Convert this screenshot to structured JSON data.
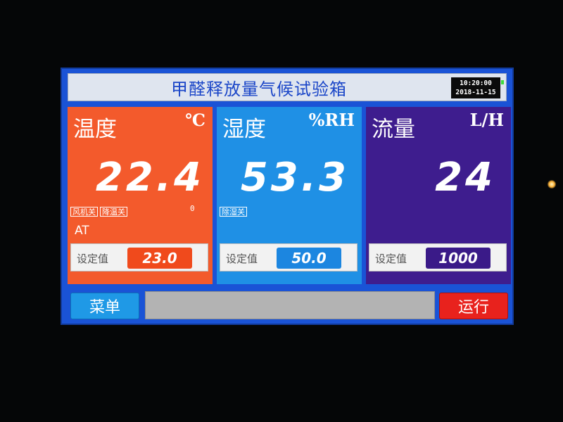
{
  "header": {
    "title": "甲醛释放量气候试验箱",
    "time": "10:20:00",
    "date": "2018-11-15"
  },
  "panels": {
    "temperature": {
      "label": "温度",
      "unit": "℃",
      "value": "22.4",
      "tags": [
        "风机关",
        "降温关"
      ],
      "indicator": "0",
      "mode": "AT",
      "setpoint_label": "设定值",
      "setpoint_value": "23.0",
      "color": "#f35a2c",
      "setpoint_color": "#f04a1c"
    },
    "humidity": {
      "label": "湿度",
      "unit": "%RH",
      "value": "53.3",
      "tags": [
        "除湿关"
      ],
      "setpoint_label": "设定值",
      "setpoint_value": "50.0",
      "color": "#1f90e5",
      "setpoint_color": "#1c86e0"
    },
    "flow": {
      "label": "流量",
      "unit": "L/H",
      "value": "24",
      "setpoint_label": "设定值",
      "setpoint_value": "1000",
      "color": "#3e1d8e",
      "setpoint_color": "#3a1a88"
    }
  },
  "footer": {
    "menu_label": "菜单",
    "run_label": "运行",
    "status_text": ""
  }
}
